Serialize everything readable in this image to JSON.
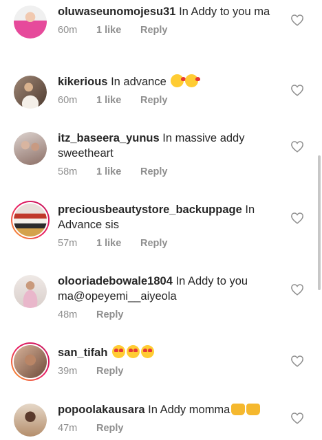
{
  "comments": [
    {
      "username": "oluwaseunomojesu31",
      "text": "In Addy to you ma",
      "time": "60m",
      "likes": "1 like",
      "reply": "Reply",
      "emoji": [],
      "ring": false,
      "avatar_color": "#e64a9b"
    },
    {
      "username": "kikerious",
      "text": "In advance",
      "time": "60m",
      "likes": "1 like",
      "reply": "Reply",
      "emoji": [
        "kiss",
        "kiss"
      ],
      "ring": false,
      "avatar_color": "#8a7060"
    },
    {
      "username": "itz_baseera_yunus",
      "text": "In massive addy sweetheart",
      "time": "58m",
      "likes": "1 like",
      "reply": "Reply",
      "emoji": [],
      "ring": false,
      "avatar_color": "#b7a8a0"
    },
    {
      "username": "preciousbeautystore_backuppage",
      "text": "In Advance sis",
      "time": "57m",
      "likes": "1 like",
      "reply": "Reply",
      "emoji": [],
      "ring": true,
      "avatar_color": "#c0392b"
    },
    {
      "username": "olooriadebowale1804",
      "text": "In Addy to you ma@opeyemi__aiyeola",
      "time": "48m",
      "likes": "",
      "reply": "Reply",
      "emoji": [],
      "ring": false,
      "avatar_color": "#e6b8c8"
    },
    {
      "username": "san_tifah",
      "text": "",
      "time": "39m",
      "likes": "",
      "reply": "Reply",
      "emoji": [
        "heart-eyes",
        "heart-eyes",
        "heart-eyes"
      ],
      "ring": true,
      "avatar_color": "#a0785a"
    },
    {
      "username": "popoolakausara",
      "text": "In Addy momma",
      "time": "47m",
      "likes": "",
      "reply": "Reply",
      "emoji": [
        "hands",
        "hands"
      ],
      "ring": false,
      "avatar_color": "#6b4a3a"
    }
  ],
  "icons": {
    "like": "heart-outline-icon"
  }
}
